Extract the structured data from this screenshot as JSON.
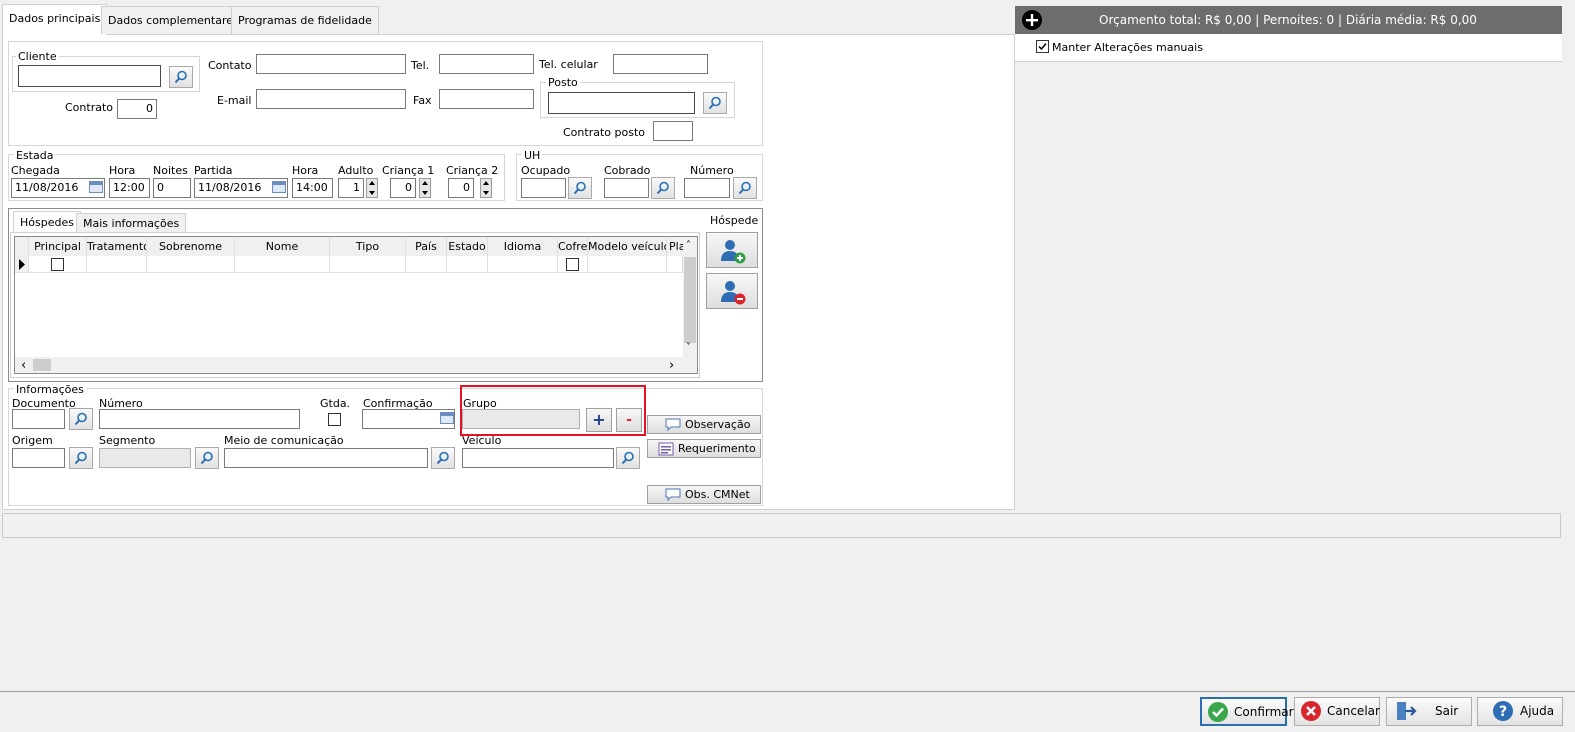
{
  "tabs": [
    "Dados principais",
    "Dados complementares",
    "Programas de fidelidade"
  ],
  "budget": {
    "summary": "Orçamento total: R$ 0,00 | Pernoites: 0 | Diária média: R$ 0,00",
    "manual_label": "Manter Alterações manuais",
    "manual_checked": true
  },
  "client": {
    "group_title": "Cliente",
    "contato_label": "Contato",
    "tel_label": "Tel.",
    "tel_celular_label": "Tel. celular",
    "email_label": "E-mail",
    "fax_label": "Fax",
    "contrato_label": "Contrato",
    "contrato_value": "0",
    "posto_title": "Posto",
    "contrato_posto_label": "Contrato posto"
  },
  "estada": {
    "title": "Estada",
    "chegada_label": "Chegada",
    "chegada_value": "11/08/2016",
    "hora1_label": "Hora",
    "hora1_value": "12:00",
    "noites_label": "Noites",
    "noites_value": "0",
    "partida_label": "Partida",
    "partida_value": "11/08/2016",
    "hora2_label": "Hora",
    "hora2_value": "14:00",
    "adulto_label": "Adulto",
    "adulto_value": "1",
    "crianca1_label": "Criança 1",
    "crianca1_value": "0",
    "crianca2_label": "Criança 2",
    "crianca2_value": "0"
  },
  "uh": {
    "title": "UH",
    "ocupado_label": "Ocupado",
    "cobrado_label": "Cobrado",
    "numero_label": "Número"
  },
  "guests": {
    "tabs": [
      "Hóspedes",
      "Mais informações"
    ],
    "columns": [
      "Principal",
      "Tratamento",
      "Sobrenome",
      "Nome",
      "Tipo",
      "País",
      "Estado",
      "Idioma",
      "Cofre",
      "Modelo veículo",
      "Placa"
    ],
    "side_title": "Hóspede"
  },
  "info": {
    "title": "Informações",
    "documento_label": "Documento",
    "numero_label": "Número",
    "gtda_label": "Gtda.",
    "confirmacao_label": "Confirmação",
    "grupo_label": "Grupo",
    "origem_label": "Origem",
    "segmento_label": "Segmento",
    "meio_label": "Meio de comunicação",
    "veiculo_label": "Veículo",
    "observacao_label": "Observação",
    "requerimento_label": "Requerimento",
    "obs_cmnet_label": "Obs. CMNet",
    "plus": "+",
    "minus": "-"
  },
  "footer": {
    "confirmar": "Confirmar",
    "cancelar": "Cancelar",
    "sair": "Sair",
    "ajuda": "Ajuda"
  },
  "colors": {
    "accent": "#2a6fb0",
    "highlight": "#e81123",
    "budget_bar": "#6d6d6d"
  }
}
